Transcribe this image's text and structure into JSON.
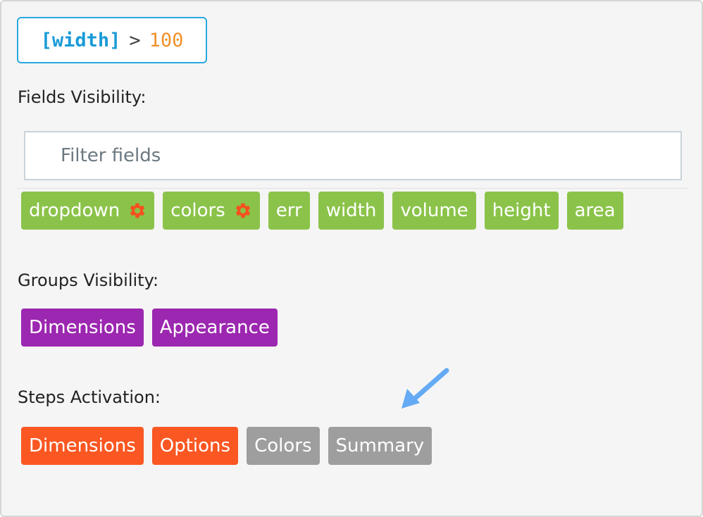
{
  "condition": {
    "field": "[width]",
    "operator": ">",
    "value": "100"
  },
  "fields_visibility": {
    "label": "Fields Visibility:",
    "filter_placeholder": "Filter fields",
    "fields": [
      {
        "label": "dropdown",
        "has_settings": true
      },
      {
        "label": "colors",
        "has_settings": true
      },
      {
        "label": "err",
        "has_settings": false
      },
      {
        "label": "width",
        "has_settings": false
      },
      {
        "label": "volume",
        "has_settings": false
      },
      {
        "label": "height",
        "has_settings": false
      },
      {
        "label": "area",
        "has_settings": false
      }
    ]
  },
  "groups_visibility": {
    "label": "Groups Visibility:",
    "groups": [
      {
        "label": "Dimensions"
      },
      {
        "label": "Appearance"
      }
    ]
  },
  "steps_activation": {
    "label": "Steps Activation:",
    "steps": [
      {
        "label": "Dimensions",
        "active": true
      },
      {
        "label": "Options",
        "active": true
      },
      {
        "label": "Colors",
        "active": false
      },
      {
        "label": "Summary",
        "active": false
      }
    ]
  },
  "colors": {
    "field_chip": "#8bc34a",
    "group_chip": "#9c27b0",
    "step_active": "#fb5722",
    "step_inactive": "#9e9e9e",
    "settings_icon": "#f4511e",
    "accent_border": "#29a8e0",
    "annotation_arrow": "#64aaf5"
  },
  "icons": {
    "field_settings": "gear-icon",
    "annotation": "arrow-pointer-icon"
  }
}
